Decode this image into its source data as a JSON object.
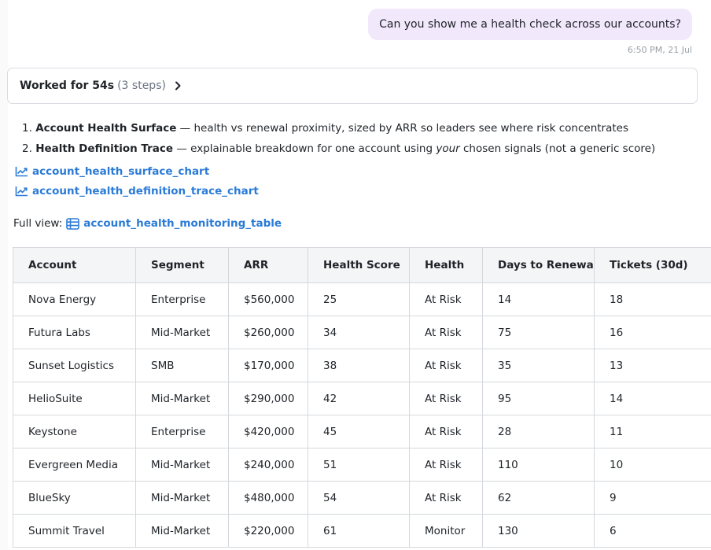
{
  "user_message": {
    "text": "Can you show me a health check across our accounts?",
    "timestamp": "6:50 PM, 21 Jul"
  },
  "worked": {
    "title": "Worked for 54s",
    "steps": "(3 steps)"
  },
  "summary": {
    "items": [
      {
        "number": "1.",
        "title": "Account Health Surface",
        "text": " — health vs renewal proximity, sized by ARR so leaders see where risk concentrates"
      },
      {
        "number": "2.",
        "title": "Health Definition Trace",
        "text_before": " — explainable breakdown for one account using ",
        "text_emph": "your",
        "text_after": " chosen signals (not a generic score)"
      }
    ]
  },
  "links": {
    "chart1": "account_health_surface_chart",
    "chart2": "account_health_definition_trace_chart",
    "full_view_label": "Full view:",
    "table_link": "account_health_monitoring_table"
  },
  "table": {
    "headers": [
      "Account",
      "Segment",
      "ARR",
      "Health Score",
      "Health",
      "Days to Renewal",
      "Tickets (30d)"
    ],
    "rows": [
      [
        "Nova Energy",
        "Enterprise",
        "$560,000",
        "25",
        "At Risk",
        "14",
        "18"
      ],
      [
        "Futura Labs",
        "Mid-Market",
        "$260,000",
        "34",
        "At Risk",
        "75",
        "16"
      ],
      [
        "Sunset Logistics",
        "SMB",
        "$170,000",
        "38",
        "At Risk",
        "35",
        "13"
      ],
      [
        "HelioSuite",
        "Mid-Market",
        "$290,000",
        "42",
        "At Risk",
        "95",
        "14"
      ],
      [
        "Keystone",
        "Enterprise",
        "$420,000",
        "45",
        "At Risk",
        "28",
        "11"
      ],
      [
        "Evergreen Media",
        "Mid-Market",
        "$240,000",
        "51",
        "At Risk",
        "110",
        "10"
      ],
      [
        "BlueSky",
        "Mid-Market",
        "$480,000",
        "54",
        "At Risk",
        "62",
        "9"
      ],
      [
        "Summit Travel",
        "Mid-Market",
        "$220,000",
        "61",
        "Monitor",
        "130",
        "6"
      ]
    ]
  },
  "icons": {
    "chart_link_icon": "line-chart-icon",
    "table_link_icon": "table-icon",
    "expand_icon": "chevron-right-icon"
  },
  "colors": {
    "bubble_bg": "#f1e8fb",
    "link": "#2b7bd6",
    "header_bg": "#f4f5f7",
    "border": "#d4d8dd"
  }
}
